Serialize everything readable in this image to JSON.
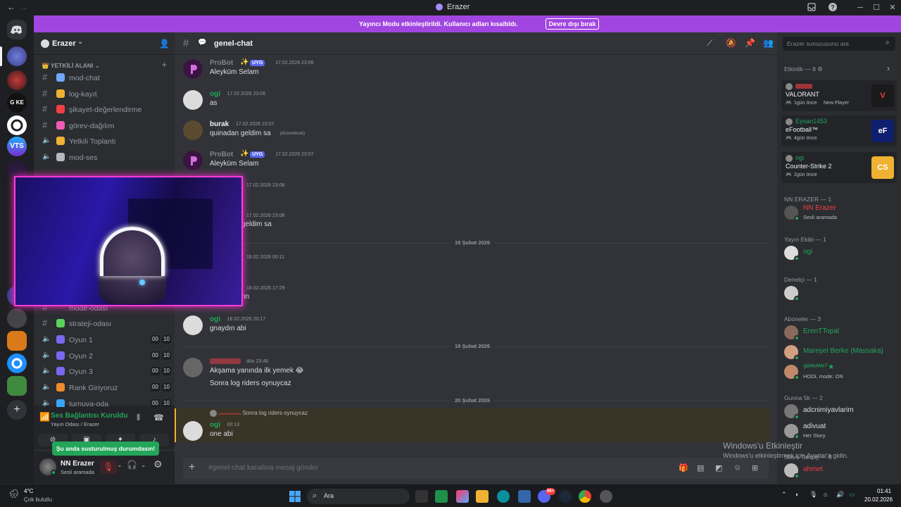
{
  "window": {
    "title": "Erazer"
  },
  "banner": {
    "message": "Yayıncı Modu etkinleştirildi. Kullanıcı adları kısaltıldı.",
    "button": "Devre dışı bırak"
  },
  "server": {
    "name": "Erazer"
  },
  "sidebar": {
    "category_label": "YETKİLİ ALANI",
    "top_channels": [
      {
        "label": "mod-chat",
        "type": "text"
      },
      {
        "label": "log-kayıt",
        "type": "text"
      },
      {
        "label": "şikayet-değerlendirme",
        "type": "text"
      },
      {
        "label": "görev-dağılım",
        "type": "text"
      },
      {
        "label": "Yetkili Toplantı",
        "type": "voice"
      },
      {
        "label": "mod-ses",
        "type": "voice"
      }
    ],
    "partial_channel": "mode-odası",
    "bottom_channels": [
      {
        "label": "strateji-odası",
        "type": "text"
      },
      {
        "label": "Oyun 1",
        "type": "voice",
        "count_a": "00",
        "count_b": "10"
      },
      {
        "label": "Oyun 2",
        "type": "voice",
        "count_a": "00",
        "count_b": "10"
      },
      {
        "label": "Oyun 3",
        "type": "voice",
        "count_a": "00",
        "count_b": "10"
      },
      {
        "label": "Rank Giriyoruz",
        "type": "voice",
        "count_a": "00",
        "count_b": "10"
      },
      {
        "label": "turnuva-oda",
        "type": "voice",
        "count_a": "00",
        "count_b": "10"
      }
    ]
  },
  "voice_panel": {
    "status": "Ses Bağlantısı Kuruldu",
    "location": "Yayın Odası / Erazer"
  },
  "tooltip": "Şu anda susturulmuş durumdasın!",
  "user_panel": {
    "name": "NN Erazer",
    "status": "Sesli aramada"
  },
  "chat": {
    "channel": "genel-chat",
    "messages": [
      {
        "author": "ProBot",
        "badge": "UYG",
        "time": "17.02.2026 23:06",
        "text": "Aleyküm Selam",
        "color": "#80848e"
      },
      {
        "author": "ogi",
        "time": "17.02.2026 23:06",
        "text": "as",
        "color": "#23a55a"
      },
      {
        "author": "burak",
        "time": "17.02.2026 23:07",
        "text": "quinadan geldim sa",
        "edited": "(düzenlendi)",
        "color": "#f2f3f5"
      },
      {
        "author": "ProBot",
        "badge": "UYG",
        "time": "17.02.2026 23:07",
        "text": "Aleyküm Selam",
        "color": "#80848e"
      },
      {
        "time": "17.02.2026 23:08"
      },
      {
        "time": "17.02.2026 23:08",
        "text": "geldim sa"
      },
      {
        "time": "18.02.2026 00:11"
      },
      {
        "time": "18.02.2026 17:29",
        "text": "nn"
      },
      {
        "author": "ogi",
        "time": "18.02.2026 20:17",
        "text": "gnaydın abi",
        "color": "#23a55a"
      },
      {
        "time": "dün 23:46",
        "text": "Akşama yanında ilk yemek 😂",
        "text2": "Sonra log riders oynuycaz"
      },
      {
        "author": "ogi",
        "time": "00:13",
        "reply": "Sonra log riders oynuycaz",
        "text": "one abi",
        "color": "#23a55a"
      }
    ],
    "dividers": [
      "18 Şubat 2026",
      "19 Şubat 2026",
      "20 Şubat 2026"
    ],
    "composer_placeholder": "#genel-chat kanalına mesaj gönder"
  },
  "members": {
    "search_placeholder": "Erazer sunucusunu ara",
    "activity_header": "Etkinlik — 8",
    "activities": [
      {
        "game": "VALORANT",
        "time": "1gün önce",
        "extra": "New Player",
        "color": "#f23f43"
      },
      {
        "user": "Eysan1453",
        "game": "eFootball™",
        "time": "4gün önce",
        "color": "#23a55a"
      },
      {
        "user": "ogi",
        "game": "Counter-Strike 2",
        "time": "2gün önce",
        "color": "#23a55a"
      }
    ],
    "groups": [
      {
        "header": "NN ERAZER — 1",
        "members": [
          {
            "name": "NN Erazer",
            "status": "Sesli aramada",
            "color": "#f23f43"
          }
        ]
      },
      {
        "header": "Yayın Ekibi — 1",
        "members": [
          {
            "name": "ogi",
            "color": "#23a55a"
          }
        ]
      },
      {
        "header": "Denetçi — 1",
        "members": [
          {
            "name": "",
            "color": "#dbdee1"
          }
        ]
      },
      {
        "header": "Aboneler — 3",
        "members": [
          {
            "name": "ErenTTopal",
            "color": "#23a55a"
          },
          {
            "name": "Mareşel Berke (Massaka)",
            "color": "#23a55a"
          },
          {
            "name": "ᵒ̷ᴳᴹᵉᴬᴹᵉᵀ★",
            "status": "HODL mode: ON",
            "color": "#23a55a"
          }
        ]
      },
      {
        "header": "Gunna 5k — 2",
        "members": [
          {
            "name": "adcnimiyavlarim",
            "color": "#dbdee1"
          },
          {
            "name": "adivuat",
            "status": "Her Story",
            "color": "#dbdee1"
          }
        ]
      },
      {
        "header": "Slave Takıpçi — 8",
        "members": [
          {
            "name": "ahmet",
            "color": "#f23f43"
          }
        ]
      }
    ]
  },
  "watermark": {
    "title": "Windows'u Etkinleştir",
    "subtitle": "Windows'u etkinleştirmek için Ayarlar'a gidin."
  },
  "taskbar": {
    "weather_temp": "4°C",
    "weather_desc": "Çok bulutlu",
    "search_label": "Ara",
    "time": "01:41",
    "date": "20.02.2026",
    "badge": "99+"
  },
  "colors": {
    "accent": "#a145e0",
    "green": "#23a55a",
    "red": "#f23f43",
    "blurple": "#5865f2"
  }
}
